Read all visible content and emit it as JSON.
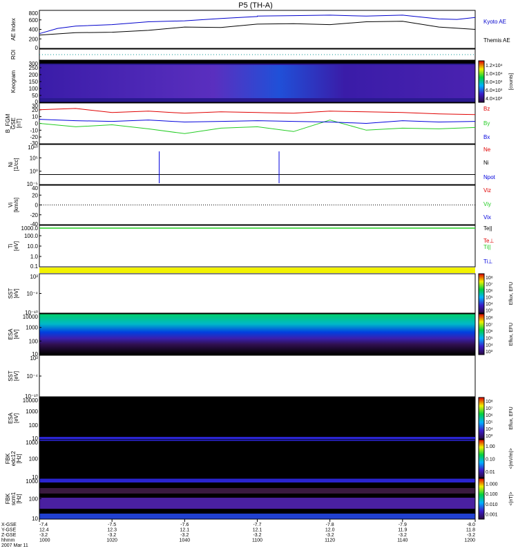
{
  "title": "P5 (TH-A)",
  "colors": {
    "red": "#e00000",
    "green": "#22cc22",
    "blue": "#0000dd",
    "yellow": "#f2f200",
    "background": "#ffffff"
  },
  "chart_data": [
    {
      "type": "line",
      "panel": "ae",
      "ylabel": "AE Index",
      "ylim": [
        0,
        800
      ],
      "yticks": [
        "0",
        "200",
        "400",
        "600",
        "800"
      ],
      "series": [
        {
          "name": "Kyoto AE",
          "color": "#0000cc",
          "x": [
            1000,
            1005,
            1010,
            1020,
            1030,
            1040,
            1050,
            1060,
            1100,
            1110,
            1120,
            1130,
            1140,
            1150,
            1155,
            1200
          ],
          "y": [
            310,
            420,
            470,
            500,
            560,
            580,
            630,
            670,
            680,
            690,
            700,
            680,
            700,
            620,
            610,
            650
          ]
        },
        {
          "name": "Themis AE",
          "color": "#000000",
          "x": [
            1000,
            1010,
            1020,
            1030,
            1040,
            1050,
            1100,
            1110,
            1120,
            1130,
            1140,
            1150,
            1200
          ],
          "y": [
            280,
            330,
            340,
            380,
            450,
            440,
            510,
            520,
            500,
            560,
            570,
            450,
            400
          ]
        }
      ]
    },
    {
      "type": "line",
      "panel": "roi",
      "ylabel": "ROI",
      "series": []
    },
    {
      "type": "heatmap",
      "panel": "keogram",
      "ylabel": "Keogram",
      "ylim": [
        0,
        300
      ],
      "yticks": [
        "0",
        "50",
        "100",
        "150",
        "200",
        "250",
        "300"
      ],
      "colorbar": {
        "label": "[counts]",
        "ticks": [
          "4.0×10³",
          "6.0×10³",
          "8.0×10³",
          "1.0×10⁴",
          "1.2×10⁴"
        ]
      }
    },
    {
      "type": "line",
      "panel": "bfgm",
      "ylabel": "B_FGM GSE [nT]",
      "ylim": [
        -30,
        30
      ],
      "yticks": [
        "-30",
        "-20",
        "-10",
        "0",
        "10",
        "20",
        "30"
      ],
      "series": [
        {
          "name": "Bz",
          "color": "#e00000",
          "x": [
            1000,
            1010,
            1020,
            1030,
            1040,
            1050,
            1100,
            1110,
            1120,
            1130,
            1140,
            1150,
            1200
          ],
          "y": [
            20,
            22,
            16,
            18,
            15,
            17,
            16,
            15,
            18,
            17,
            16,
            14,
            13
          ]
        },
        {
          "name": "By",
          "color": "#22cc22",
          "x": [
            1000,
            1010,
            1020,
            1030,
            1040,
            1050,
            1100,
            1110,
            1120,
            1130,
            1140,
            1150,
            1200
          ],
          "y": [
            0,
            -5,
            -2,
            -8,
            -15,
            -7,
            -5,
            -12,
            5,
            -10,
            -7,
            -8,
            -6
          ]
        },
        {
          "name": "Bx",
          "color": "#0000dd",
          "x": [
            1000,
            1010,
            1020,
            1030,
            1040,
            1050,
            1100,
            1110,
            1120,
            1130,
            1140,
            1150,
            1200
          ],
          "y": [
            6,
            4,
            3,
            5,
            2,
            3,
            4,
            3,
            2,
            0,
            4,
            2,
            3
          ]
        }
      ]
    },
    {
      "type": "line",
      "panel": "ni",
      "ylabel": "Ni [1/cc]",
      "yticks": [
        "10⁻⁵",
        "10⁰",
        "10⁵",
        "10¹⁰"
      ],
      "legend": [
        "Ne",
        "Ni",
        "Npot"
      ]
    },
    {
      "type": "line",
      "panel": "vi",
      "ylabel": "Vi [km/s]",
      "ylim": [
        -50,
        50
      ],
      "yticks": [
        "-40",
        "-20",
        "0",
        "20",
        "40"
      ],
      "legend": [
        "Viz",
        "Viy",
        "Vix"
      ]
    },
    {
      "type": "line",
      "panel": "ti",
      "ylabel": "Ti [eV]",
      "yticks": [
        "0.1",
        "1.0",
        "10.0",
        "100.0",
        "1000.0"
      ],
      "legend": [
        "Te||",
        "Te⊥",
        "Ti||",
        "Ti⊥"
      ],
      "series": [
        {
          "name": "Ti||",
          "color": "#22cc22",
          "x": [
            1000,
            1200
          ],
          "y": [
            2000,
            2000
          ]
        }
      ]
    },
    {
      "type": "heatmap",
      "panel": "sst-omni",
      "ylabel": "SST omni [eV]",
      "yticks": [
        "10⁻¹⁰",
        "10⁻⁴",
        "10²"
      ],
      "colorbar": {
        "label": "Eflux, EFU",
        "ticks": [
          "10³",
          "10⁴",
          "10⁵",
          "10⁶",
          "10⁷",
          "10⁸"
        ]
      }
    },
    {
      "type": "heatmap",
      "panel": "esa-omni",
      "ylabel": "ESA omni [eV]",
      "yticks": [
        "10",
        "100",
        "1000",
        "10000"
      ],
      "colorbar": {
        "label": "Eflux, EFU",
        "ticks": [
          "10³",
          "10⁴",
          "10⁵",
          "10⁶",
          "10⁷",
          "10⁸"
        ]
      }
    },
    {
      "type": "heatmap",
      "panel": "sst-elec",
      "ylabel": "SST e [eV]",
      "yticks": [
        "10⁻¹⁰",
        "10⁻⁴",
        "10²"
      ]
    },
    {
      "type": "heatmap",
      "panel": "esa-elec",
      "ylabel": "ESA e [eV]",
      "yticks": [
        "10",
        "100",
        "1000",
        "10000"
      ],
      "colorbar": {
        "label": "Eflux, EFU",
        "ticks": [
          "10³",
          "10⁴",
          "10⁵",
          "10⁶",
          "10⁷",
          "10⁸"
        ]
      }
    },
    {
      "type": "heatmap",
      "panel": "fbk-e12",
      "ylabel": "FBK edc12 [Hz]",
      "yticks": [
        "10",
        "100",
        "1000"
      ],
      "colorbar": {
        "label": "<|mV/m|>",
        "ticks": [
          "0.01",
          "0.10",
          "1.00"
        ]
      }
    },
    {
      "type": "heatmap",
      "panel": "fbk-scm",
      "ylabel": "FBK scm1 [Hz]",
      "yticks": [
        "10",
        "100",
        "1000"
      ],
      "colorbar": {
        "label": "<|nT|>",
        "ticks": [
          "0.001",
          "0.010",
          "0.100",
          "1.000"
        ]
      }
    }
  ],
  "x_axis": {
    "row_labels": [
      "X-GSE",
      "Y-GSE",
      "Z-GSE",
      "hhmm",
      "2007 Mar 11"
    ],
    "columns": [
      [
        "-7.4",
        "12.4",
        "-3.2",
        "1000"
      ],
      [
        "-7.5",
        "12.3",
        "-3.2",
        "1020"
      ],
      [
        "-7.6",
        "12.1",
        "-3.2",
        "1040"
      ],
      [
        "-7.7",
        "12.1",
        "-3.2",
        "1100"
      ],
      [
        "-7.8",
        "12.0",
        "-3.2",
        "1120"
      ],
      [
        "-7.9",
        "11.9",
        "-3.2",
        "1140"
      ],
      [
        "-8.0",
        "11.8",
        "-3.2",
        "1200"
      ]
    ]
  }
}
